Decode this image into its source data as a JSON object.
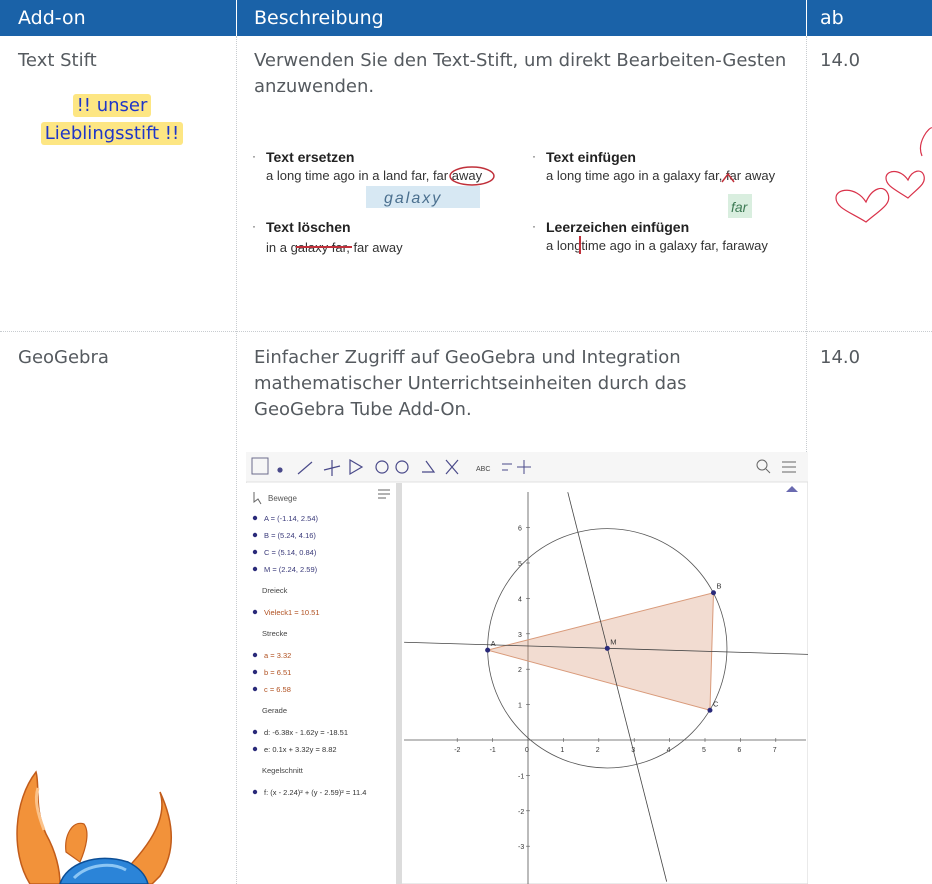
{
  "header": {
    "col1": "Add-on",
    "col2": "Beschreibung",
    "col3": "ab"
  },
  "rows": [
    {
      "name": "Text Stift",
      "description": "Verwenden Sie den Text-Stift, um direkt Bearbeiten-Gesten anzuwenden.",
      "version": "14.0",
      "sticker": [
        "!! unser",
        "Lieblingsstift !!"
      ],
      "example": {
        "replace_title": "Text ersetzen",
        "replace_text": "a long time ago in a land far, far away",
        "replace_handwriting": "galaxy",
        "insert_title": "Text einfügen",
        "insert_text": "a long time ago in a galaxy far, far away",
        "insert_handwriting": "far",
        "delete_title": "Text löschen",
        "delete_text": "in a galaxy far, far away",
        "space_title": "Leerzeichen einfügen",
        "space_text": "a longtime ago in a galaxy far, faraway"
      }
    },
    {
      "name": "GeoGebra",
      "description": "Einfacher Zugriff auf GeoGebra und Integration mathematischer Unterrichtseinheiten durch das GeoGebra Tube Add-On.",
      "version": "14.0",
      "geogebra": {
        "move_label": "Bewege",
        "points": [
          "A = (-1.14, 2.54)",
          "B = (5.24, 4.16)",
          "C = (5.14, 0.84)",
          "M = (2.24, 2.59)"
        ],
        "triangle_header": "Dreieck",
        "polygon": "Vieleck1 = 10.51",
        "segment_header": "Strecke",
        "segments": [
          "a = 3.32",
          "b = 6.51",
          "c = 6.58"
        ],
        "line_header": "Gerade",
        "lines": [
          "d: -6.38x - 1.62y = -18.51",
          "e: 0.1x + 3.32y = 8.82"
        ],
        "conic_header": "Kegelschnitt",
        "conic": "f: (x - 2.24)² + (y - 2.59)² = 11.4",
        "abc_button": "ABC",
        "x_ticks": [
          "-2",
          "-1",
          "0",
          "1",
          "2",
          "3",
          "4",
          "5",
          "6",
          "7"
        ],
        "y_ticks": [
          "6",
          "5",
          "4",
          "3",
          "2",
          "1",
          "-1",
          "-2",
          "-3"
        ],
        "point_labels": [
          "A",
          "B",
          "C",
          "M"
        ],
        "accent": "#d99a7a",
        "point_color": "#2a2a7a"
      }
    }
  ],
  "colors": {
    "header_bg": "#1a62a8",
    "sticker_bg": "#fde683",
    "sticker_text": "#1f36c8",
    "heart": "#d9324a"
  }
}
